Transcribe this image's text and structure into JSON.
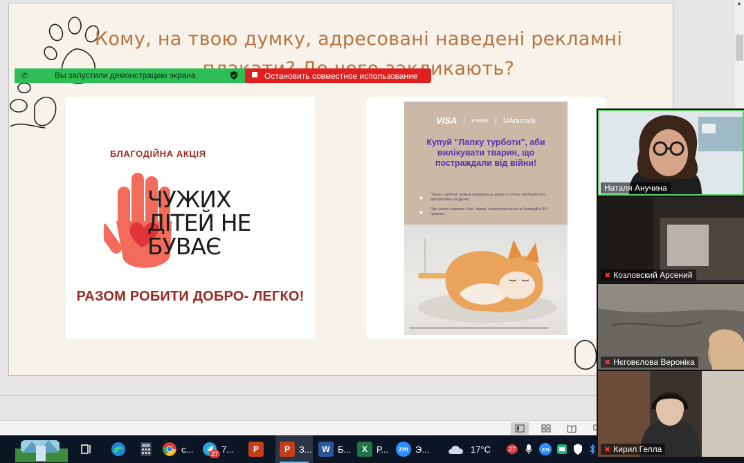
{
  "slide": {
    "title": "Кому, на твою думку, адресовані наведені рекламні плакати? До чого закликають?",
    "poster1": {
      "top_text": "БЛАГОДІЙНА АКЦІЯ",
      "big_text_1": "ЧУЖИХ",
      "big_text_2": "ДІТЕЙ НЕ",
      "big_text_3": "БУВАЄ",
      "bottom_text": "РАЗОМ РОБИТИ ДОБРО- ЛЕГКО!",
      "colors": {
        "hand": "#f26b5b",
        "heart": "#e0343a",
        "text_red": "#9b2a24"
      }
    },
    "poster2": {
      "brand_1": "VISA",
      "brand_2": "master",
      "brand_3": "UAnimals",
      "headline": "Купуй \"Лапку турботи\", аби вилікувати тварин, що постраждали від війни!",
      "line_1": "\"Лапку турботи\" можна отримати за донат в 10 грн, які MasterZoo автоматично подвоює.",
      "line_2": "При оплаті карткою Visa \"лапка\" перетворюється на благодійні 40 гривень."
    }
  },
  "share_banner": {
    "status": "Вы запустили демонстрацию экрана",
    "stop": "Остановить совместное использование"
  },
  "participants": [
    {
      "name": "Наталя Анучина",
      "muted": false
    },
    {
      "name": "Козловский Арсений",
      "muted": true
    },
    {
      "name": "Нєговєлова Вероніка",
      "muted": true
    },
    {
      "name": "Кирил Гелла",
      "muted": true
    }
  ],
  "taskbar": {
    "chrome": "c...",
    "telegram": "7...",
    "telegram_badge": "27",
    "ppt_active": "З...",
    "word": "Б...",
    "excel": "Р...",
    "zoom": "Э...",
    "weather": "17°C",
    "tray_badge": "27"
  },
  "accent": {
    "title": "#b8733f",
    "share_green": "#2dbf55",
    "share_red": "#e02020",
    "taskbar": "#0c1524"
  }
}
